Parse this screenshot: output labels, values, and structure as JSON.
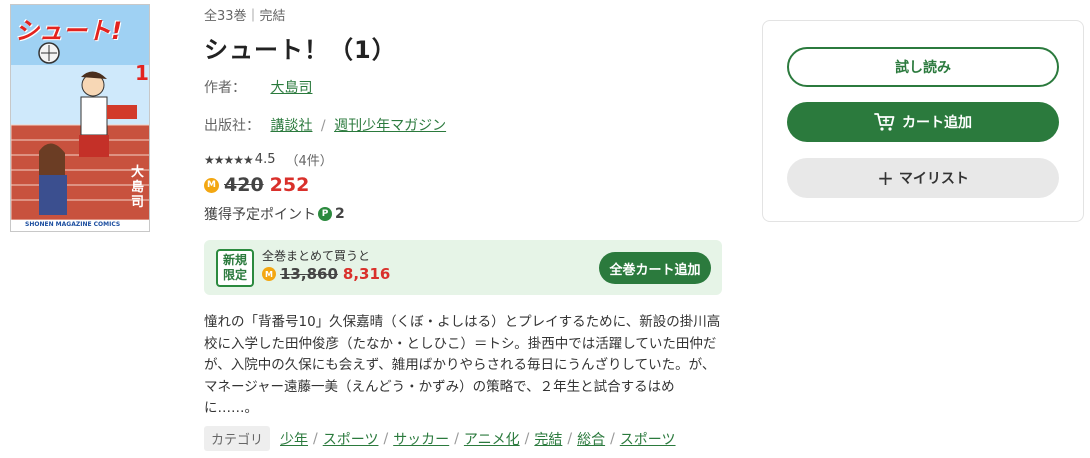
{
  "product": {
    "volume_info": "全33巻｜完結",
    "title": "シュート！（1）",
    "author_label": "作者：",
    "author": "大島司",
    "publisher_label": "出版社：",
    "publisher": "講談社",
    "publisher_sep": "/",
    "magazine": "週刊少年マガジン",
    "stars": "★★★★★",
    "rating": "4.5",
    "review_count": "（4件）",
    "coin_icon": "M",
    "price_original": "420",
    "price_sale": "252",
    "points_label": "獲得予定ポイント",
    "points_icon": "P",
    "points_value": "2"
  },
  "cover": {
    "title_text": "シュート!",
    "volume_number": "1",
    "author_text": "大島司",
    "imprint": "SHONEN MAGAZINE COMICS"
  },
  "bulk": {
    "badge_line1": "新規",
    "badge_line2": "限定",
    "label": "全巻まとめて買うと",
    "coin_icon": "M",
    "price_original": "13,860",
    "price_sale": "8,316",
    "button": "全巻カート追加"
  },
  "description": "憧れの「背番号10」久保嘉晴（くぼ・よしはる）とプレイするために、新設の掛川高校に入学した田仲俊彦（たなか・としひこ）＝トシ。掛西中では活躍していた田仲だが、入院中の久保にも会えず、雑用ばかりやらされる毎日にうんざりしていた。が、マネージャー遠藤一美（えんどう・かずみ）の策略で、２年生と試合するはめに……。",
  "categories": {
    "label": "カテゴリ",
    "sep": "/",
    "items": [
      "少年",
      "スポーツ",
      "サッカー",
      "アニメ化",
      "完結",
      "総合",
      "スポーツ"
    ]
  },
  "actions": {
    "sample": "試し読み",
    "cart": "カート追加",
    "mylist_plus": "+",
    "mylist": "マイリスト"
  },
  "colors": {
    "accent_green": "#2b7a3d",
    "sale_red": "#d9302b",
    "coin_orange": "#f3a712"
  }
}
